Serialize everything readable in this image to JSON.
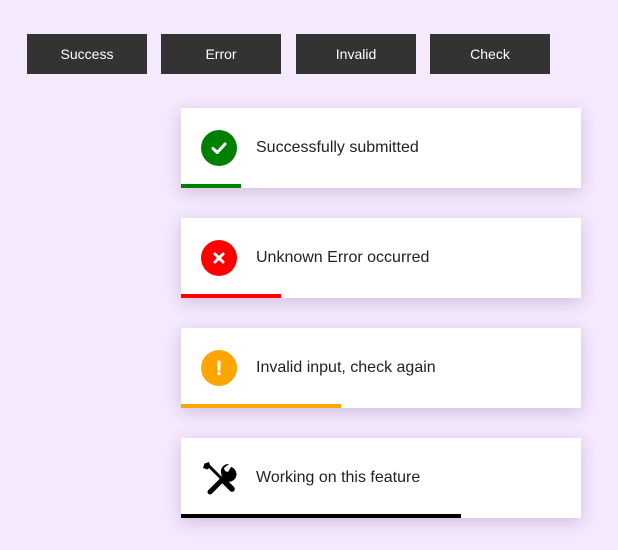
{
  "buttons": [
    {
      "label": "Success"
    },
    {
      "label": "Error"
    },
    {
      "label": "Invalid"
    },
    {
      "label": "Check"
    }
  ],
  "toasts": [
    {
      "message": "Successfully submitted",
      "icon": "check-circle-icon",
      "color": "#008000",
      "progress": 0.15
    },
    {
      "message": "Unknown Error occurred",
      "icon": "x-circle-icon",
      "color": "#ff0000",
      "progress": 0.25
    },
    {
      "message": "Invalid input, check again",
      "icon": "exclamation-circle-icon",
      "color": "#ffa500",
      "progress": 0.4
    },
    {
      "message": "Working on this feature",
      "icon": "tools-icon",
      "color": "#000000",
      "progress": 0.7
    }
  ]
}
